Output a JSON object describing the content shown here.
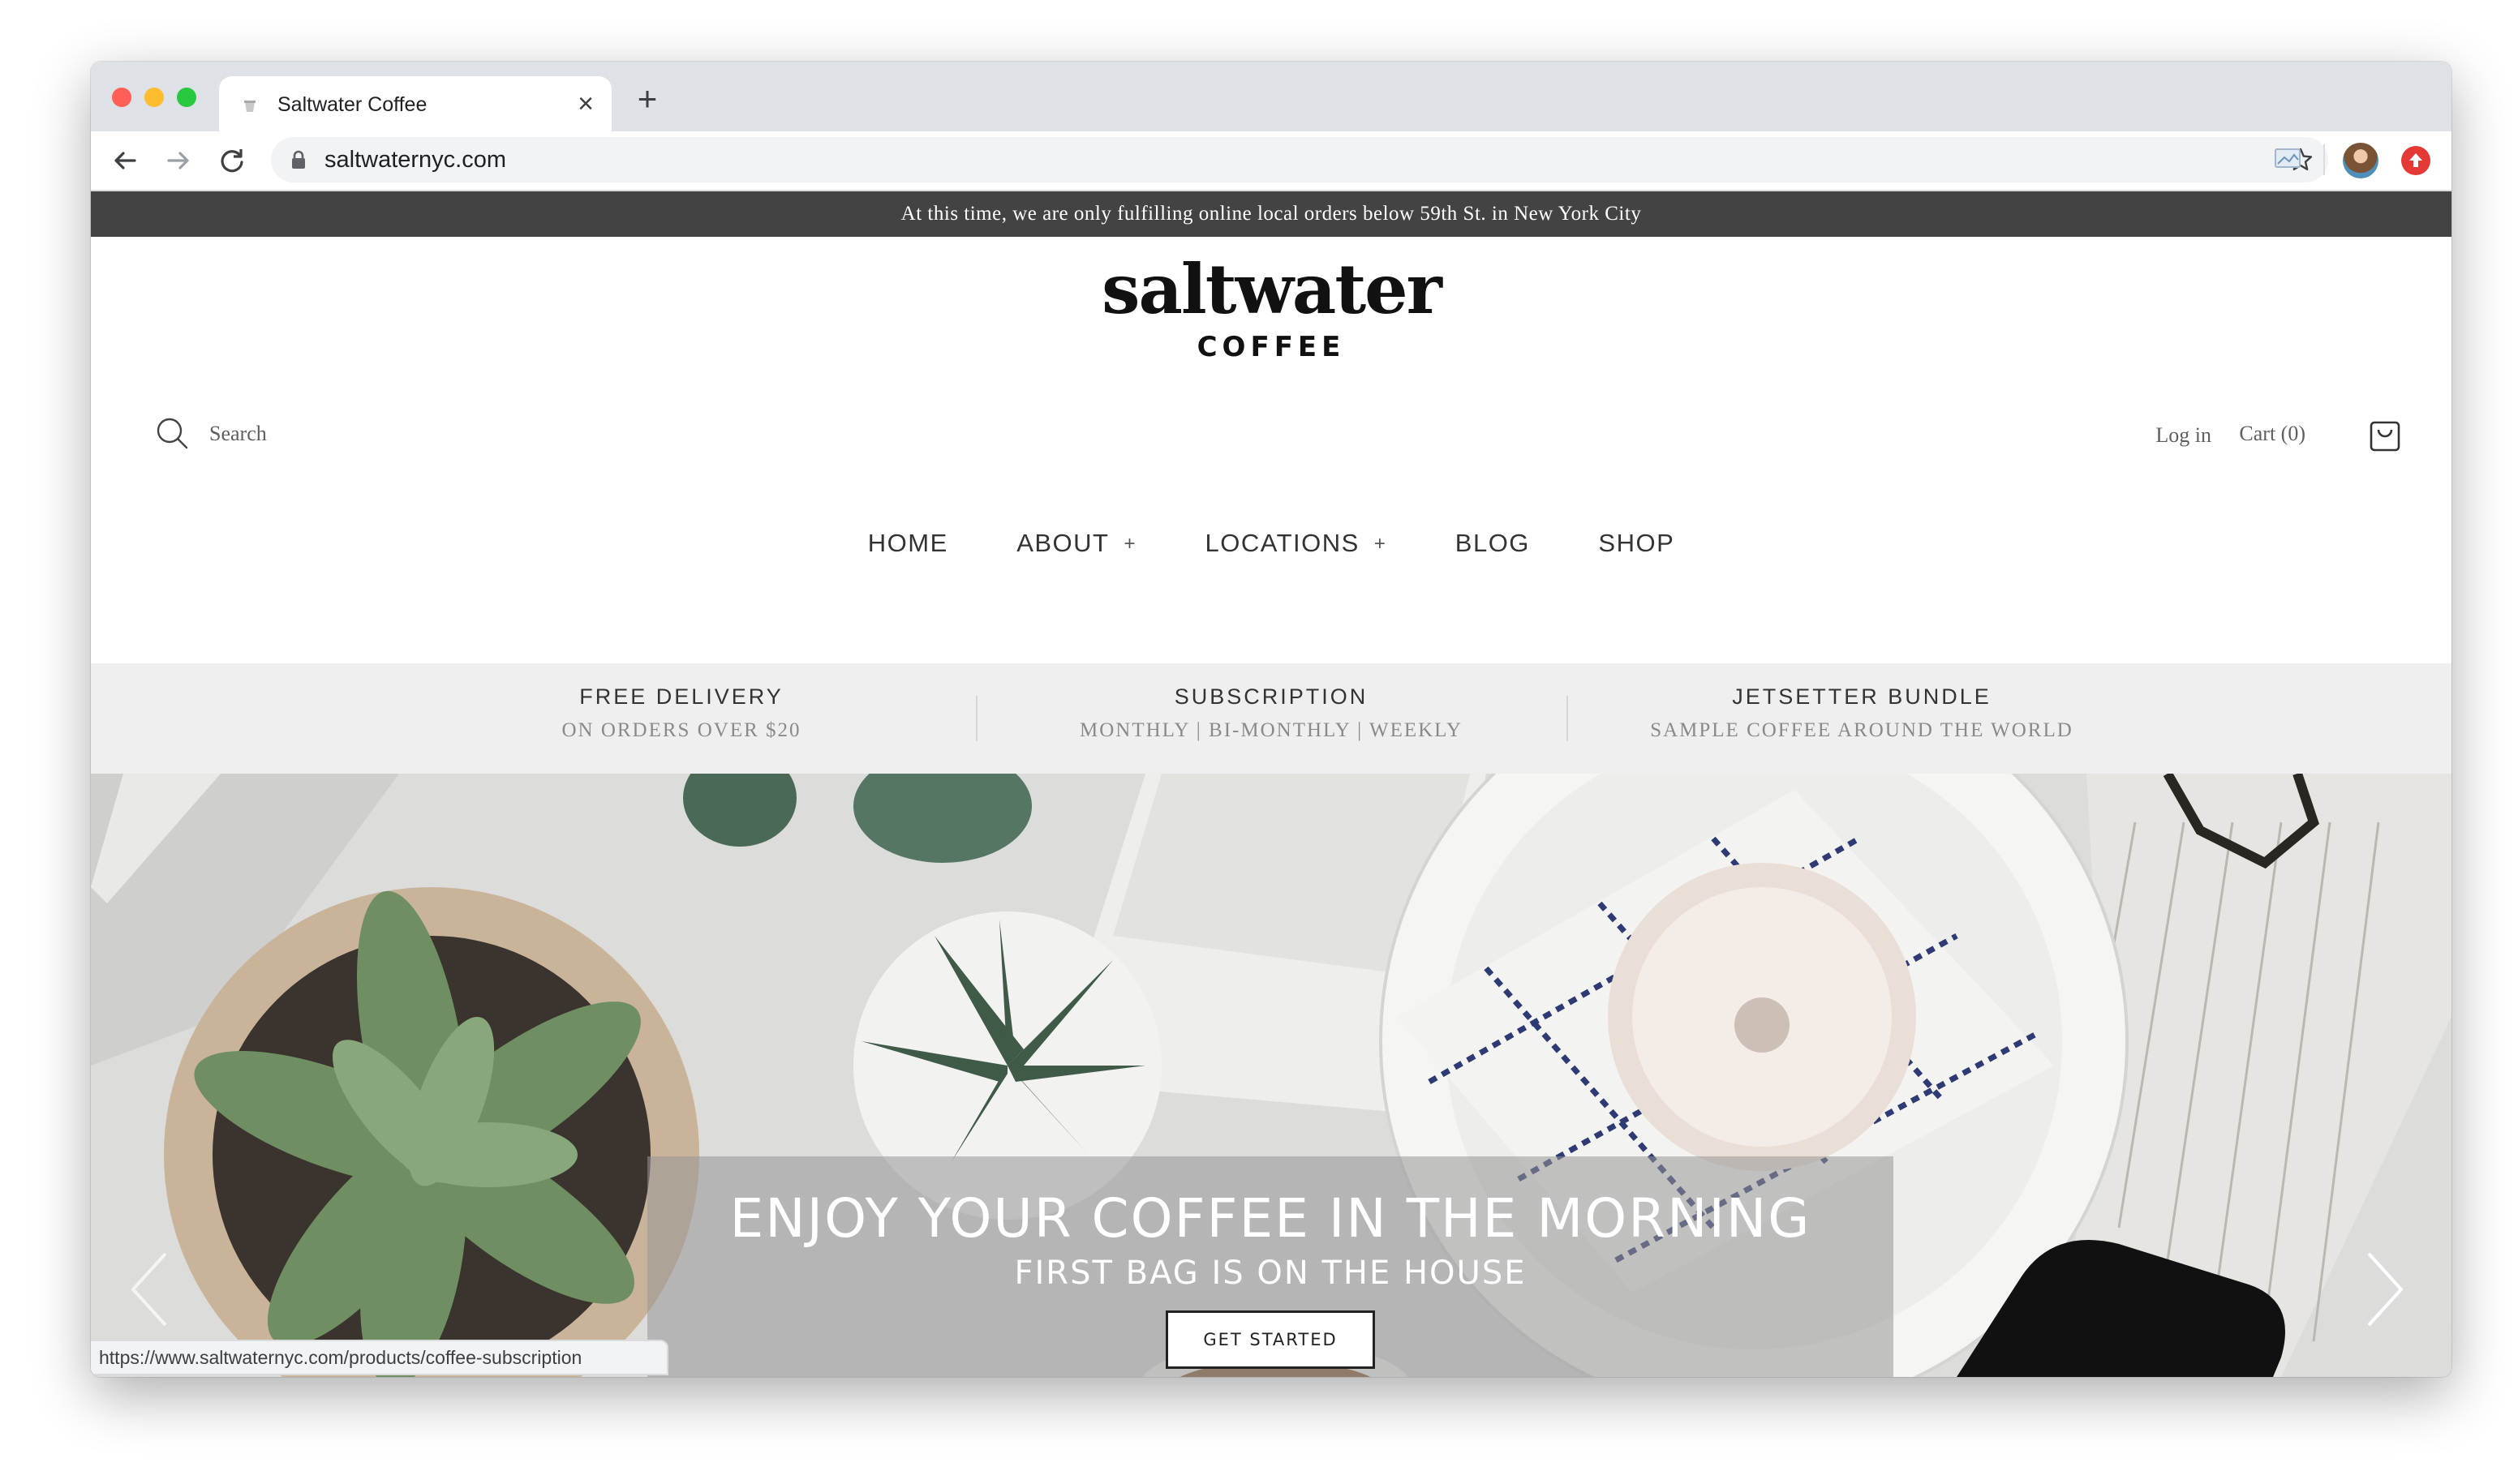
{
  "browser": {
    "tab_title": "Saltwater Coffee",
    "tab_close": "×",
    "new_tab": "+",
    "url": "saltwaternyc.com",
    "status_url": "https://www.saltwaternyc.com/products/coffee-subscription"
  },
  "announcement": "At this time, we are only fulfilling online local orders below 59th St. in New York City",
  "header": {
    "logo_word": "saltwater",
    "logo_sub": "COFFEE",
    "search_label": "Search",
    "login": "Log in",
    "cart": "Cart (0)"
  },
  "nav": {
    "items": [
      {
        "label": "HOME",
        "has_submenu": false
      },
      {
        "label": "ABOUT",
        "has_submenu": true
      },
      {
        "label": "LOCATIONS",
        "has_submenu": true
      },
      {
        "label": "BLOG",
        "has_submenu": false
      },
      {
        "label": "SHOP",
        "has_submenu": false
      }
    ],
    "submenu_symbol": "+"
  },
  "promo": [
    {
      "title": "FREE DELIVERY",
      "subtitle": "ON ORDERS OVER $20"
    },
    {
      "title": "SUBSCRIPTION",
      "subtitle": "MONTHLY | BI-MONTHLY | WEEKLY"
    },
    {
      "title": "JETSETTER BUNDLE",
      "subtitle": "SAMPLE COFFEE AROUND THE WORLD"
    }
  ],
  "hero": {
    "title": "ENJOY YOUR COFFEE IN THE MORNING",
    "subtitle": "FIRST BAG IS ON THE HOUSE",
    "button": "GET STARTED"
  },
  "colors": {
    "announcement_bg": "#434343",
    "promo_bg": "#efefef",
    "tab_strip": "#dee1e6"
  },
  "icons": [
    "back-arrow-icon",
    "forward-arrow-icon",
    "reload-icon",
    "lock-icon",
    "star-icon",
    "search-icon",
    "cart-icon",
    "chevron-left-icon",
    "chevron-right-icon"
  ]
}
